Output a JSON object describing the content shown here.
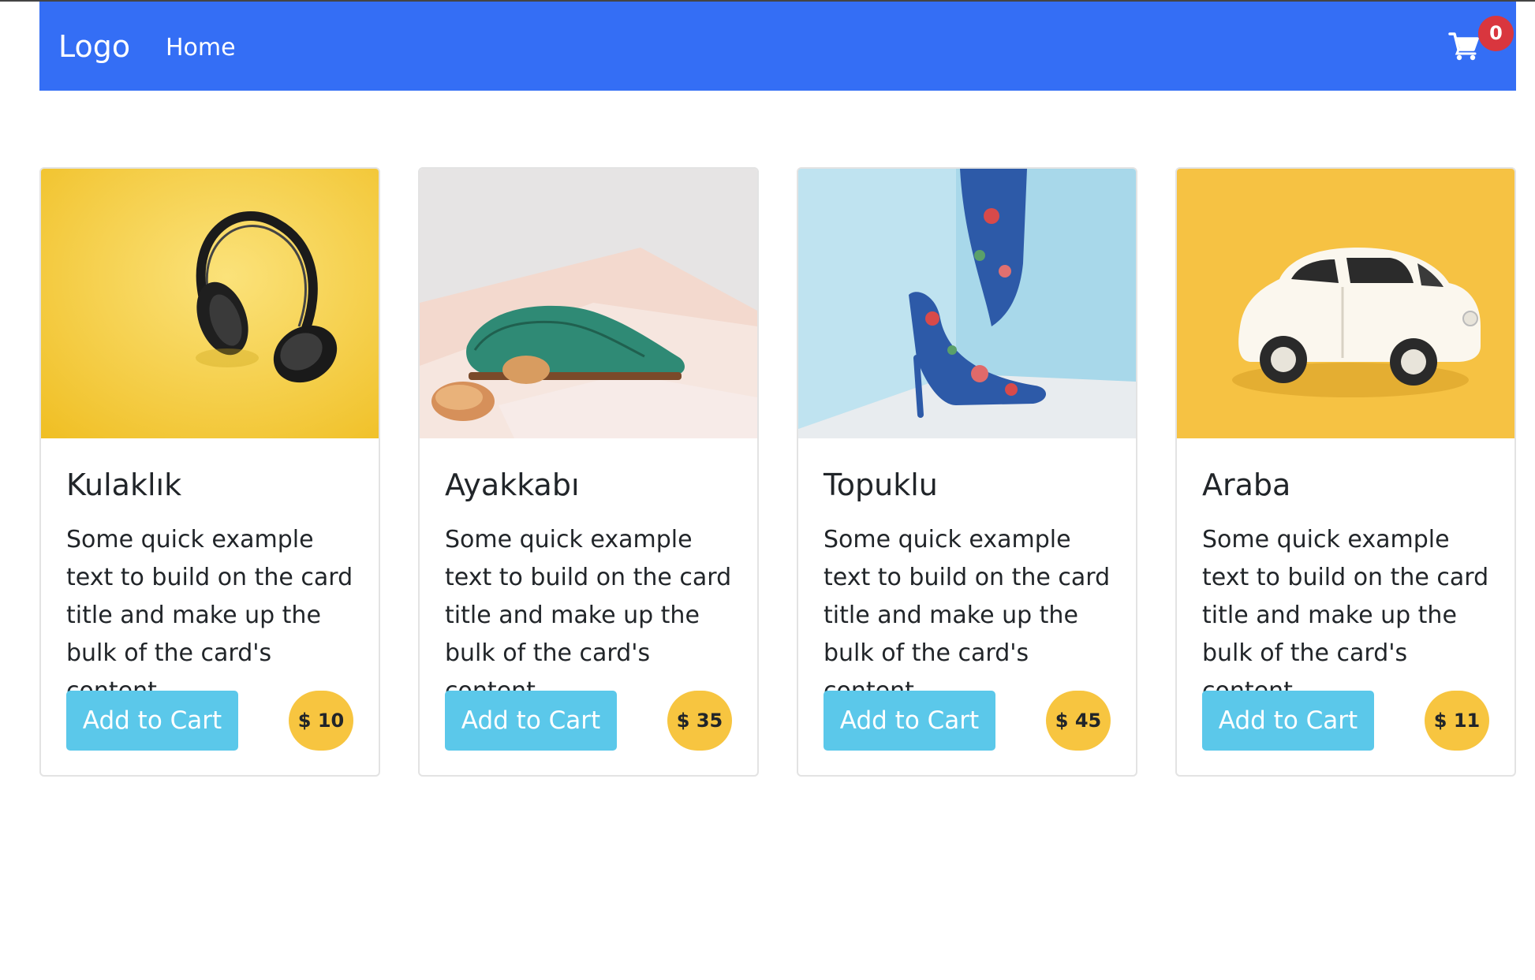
{
  "navbar": {
    "brand": "Logo",
    "home_link": "Home",
    "cart_icon": "shopping-cart-icon",
    "cart_count": "0",
    "bg_color": "#346ef5",
    "badge_color": "#d9363e"
  },
  "products": [
    {
      "title": "Kulaklık",
      "text": "Some quick example text to build on the card title and make up the bulk of the card's content.",
      "button_label": "Add to Cart",
      "price": "$ 10",
      "image": "headphones"
    },
    {
      "title": "Ayakkabı",
      "text": "Some quick example text to build on the card title and make up the bulk of the card's content.",
      "button_label": "Add to Cart",
      "price": "$ 35",
      "image": "green-shoe"
    },
    {
      "title": "Topuklu",
      "text": "Some quick example text to build on the card title and make up the bulk of the card's content.",
      "button_label": "Add to Cart",
      "price": "$ 45",
      "image": "high-heels"
    },
    {
      "title": "Araba",
      "text": "Some quick example text to build on the card title and make up the bulk of the card's content.",
      "button_label": "Add to Cart",
      "price": "$ 11",
      "image": "toy-car"
    }
  ],
  "colors": {
    "button": "#5bc8ea",
    "price_badge": "#f7c540"
  }
}
